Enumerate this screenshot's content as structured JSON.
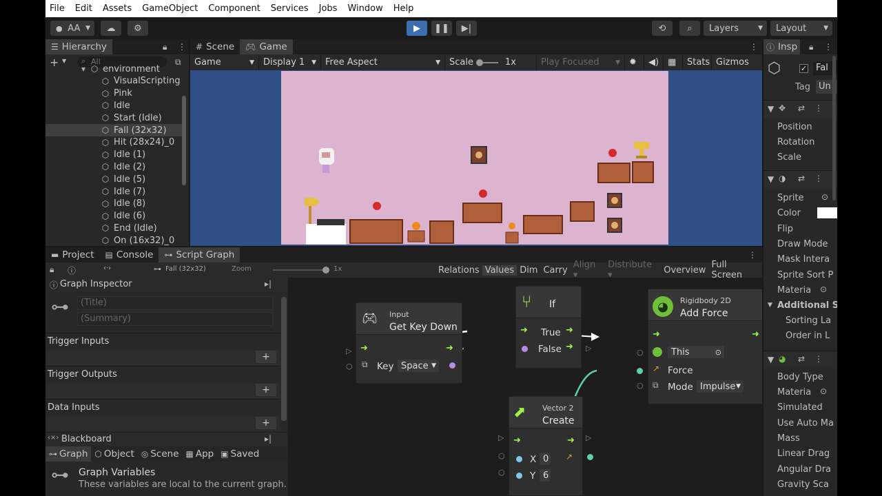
{
  "menu": [
    "File",
    "Edit",
    "Assets",
    "GameObject",
    "Component",
    "Services",
    "Jobs",
    "Window",
    "Help"
  ],
  "toolbar": {
    "account": "AA",
    "layers": "Layers",
    "layout": "Layout"
  },
  "hierarchy": {
    "tab": "Hierarchy",
    "search_placeholder": "All",
    "items": [
      "environment",
      "VisualScripting",
      "Pink",
      "Idle",
      "Start (Idle)",
      "Fall (32x32)",
      "Hit (28x24)_0",
      "Idle (1)",
      "Idle (2)",
      "Idle (5)",
      "Idle (7)",
      "Idle (8)",
      "Idle (6)",
      "End (Idle)",
      "On (16x32)_0"
    ],
    "selected_index": 5
  },
  "game": {
    "tabs": [
      "Scene",
      "Game"
    ],
    "display_mode": "Game",
    "display": "Display 1",
    "aspect": "Free Aspect",
    "scale_label": "Scale",
    "scale_value": "1x",
    "play_focused": "Play Focused",
    "stats": "Stats",
    "gizmos": "Gizmos",
    "colors": {
      "background": "#2f4f86",
      "sky": "#dcb4d0"
    }
  },
  "inspector": {
    "tab": "Insp",
    "name": "Fal",
    "tag_label": "Tag",
    "tag_value": "Un",
    "transform": [
      "Position",
      "Rotation",
      "Scale"
    ],
    "sprite": [
      "Sprite",
      "Color",
      "Flip",
      "Draw Mode",
      "Mask Intera",
      "Sprite Sort P",
      "Materia"
    ],
    "additional": "Additional S",
    "additional_items": [
      "Sorting La",
      "Order in L"
    ],
    "rigidbody": [
      "Body Type",
      "Materia",
      "Simulated",
      "Use Auto Ma",
      "Mass",
      "Linear Drag",
      "Angular Dra",
      "Gravity Sca"
    ]
  },
  "bottom": {
    "tabs": [
      "Project",
      "Console",
      "Script Graph"
    ],
    "breadcrumb": "Fall (32x32)",
    "zoom_label": "Zoom",
    "zoom_value": "1x",
    "toolbar": [
      "Relations",
      "Values",
      "Dim",
      "Carry",
      "Align",
      "Distribute",
      "Overview",
      "Full Screen"
    ]
  },
  "graph_inspector": {
    "title": "Graph Inspector",
    "title_placeholder": "(Title)",
    "summary_placeholder": "(Summary)",
    "sections": [
      "Trigger Inputs",
      "Trigger Outputs",
      "Data Inputs"
    ],
    "blackboard": "Blackboard",
    "bb_tabs": [
      "Graph",
      "Object",
      "Scene",
      "App",
      "Saved"
    ],
    "vars_title": "Graph Variables",
    "vars_desc": "These variables are local to the current graph."
  },
  "nodes": {
    "input": {
      "category": "Input",
      "title": "Get Key Down",
      "key_label": "Key",
      "key_value": "Space"
    },
    "if": {
      "title": "If",
      "true": "True",
      "false": "False"
    },
    "rigidbody": {
      "category": "Rigidbody 2D",
      "title": "Add Force",
      "this": "This",
      "force": "Force",
      "mode_label": "Mode",
      "mode_value": "Impulse"
    },
    "vector": {
      "category": "Vector 2",
      "title": "Create",
      "x_label": "X",
      "x_value": "0",
      "y_label": "Y",
      "y_value": "6"
    }
  }
}
